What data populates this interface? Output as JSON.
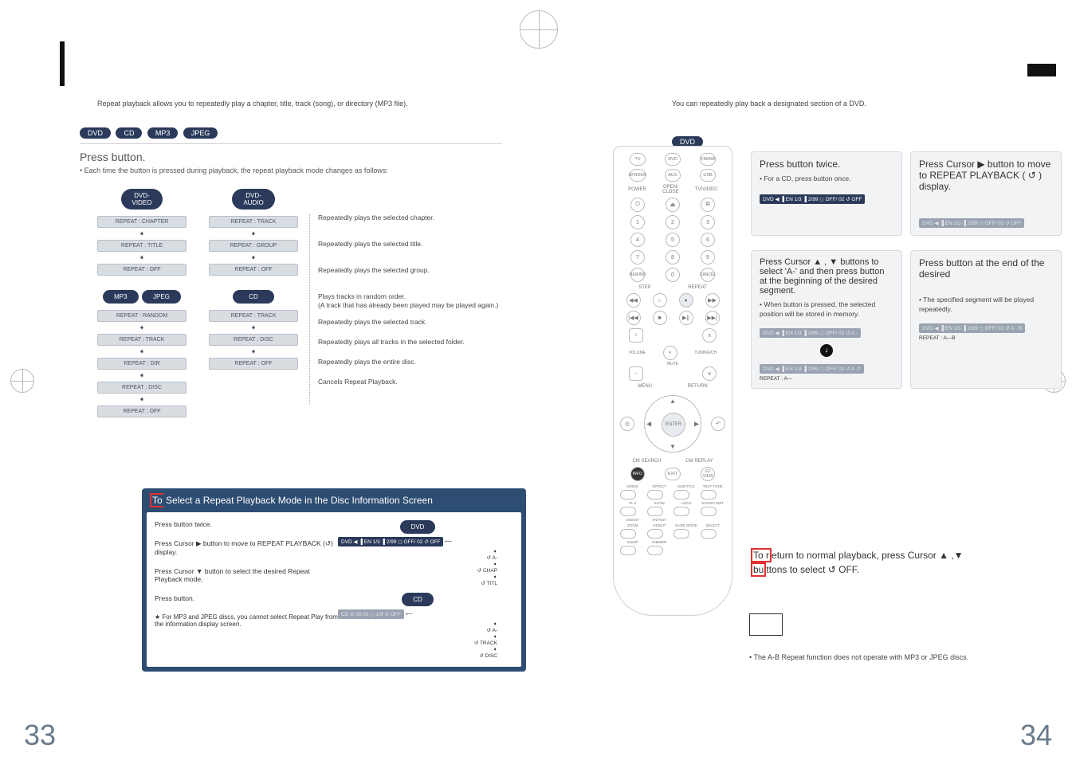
{
  "left": {
    "intro": "Repeat playback allows you to repeatedly play a chapter, title, track (song), or directory (MP3 file).",
    "pills": [
      "DVD",
      "CD",
      "MP3",
      "JPEG"
    ],
    "press_title": "Press                 button.",
    "press_sub": "• Each time the button is pressed during playback, the repeat playback mode changes as follows:",
    "trees": {
      "dvd_video": {
        "label": "DVD-\nVIDEO",
        "items": [
          "REPEAT : CHAPTER",
          "REPEAT : TITLE",
          "REPEAT : OFF"
        ]
      },
      "dvd_audio": {
        "label": "DVD-\nAUDIO",
        "items": [
          "REPEAT : TRACK",
          "REPEAT : GROUP",
          "REPEAT : OFF"
        ]
      },
      "mp3_jpeg": {
        "label_a": "MP3",
        "label_b": "JPEG",
        "items": [
          "REPEAT : RANDOM",
          "REPEAT : TRACK",
          "REPEAT : DIR",
          "REPEAT : DISC",
          "REPEAT : OFF"
        ]
      },
      "cd": {
        "label": "CD",
        "items": [
          "REPEAT : TRACK",
          "REPEAT : DISC",
          "REPEAT : OFF"
        ]
      }
    },
    "descs": [
      "Repeatedly plays the selected chapter.",
      "Repeatedly plays the selected title.",
      "Repeatedly plays the selected group.",
      "Plays tracks in random order.\n(A track that has already been played may be played again.)",
      "Repeatedly plays the selected track.",
      "Repeatedly plays all tracks in the selected folder.",
      "Repeatedly plays the entire disc.",
      "Cancels Repeat Playback."
    ],
    "blue_panel": {
      "title": "To Select a Repeat Playback Mode in the Disc Information Screen",
      "steps": [
        "Press            button twice.",
        "Press Cursor ▶ button to move to REPEAT PLAYBACK (↺) display.",
        "Press Cursor ▼ button to select the desired Repeat Playback mode.",
        "Press            button."
      ],
      "footnote": "★ For MP3 and JPEG discs, you cannot select Repeat Play from the information display screen.",
      "dvd_pill": "DVD",
      "cd_pill": "CD",
      "osd1": "DVD  ◀ ▐ EN 1/3 ▐ 2/99 ◻ OFF/ 02  ↺ OFF",
      "list1": [
        "↺ A-",
        "↺ CHAP",
        "↺ TITL"
      ],
      "osd2": "CD  ⊘ 00:02  ◻ 1/9     ↺ OFF",
      "list2": [
        "↺ A-",
        "↺ TRACK",
        "↺ DISC"
      ]
    }
  },
  "right": {
    "intro": "You can repeatedly play back a designated section of a DVD.",
    "pill": "DVD",
    "boxes": {
      "b1": {
        "title": "Press              button twice.",
        "sub": "• For a CD, press            button once.",
        "osd": "DVD  ◀ ▐ EN 1/3 ▐ 2/99 ◻ OFF/ 02  ↺ OFF"
      },
      "b2": {
        "title": "Press Cursor ▶ button to move to REPEAT PLAYBACK ( ↺ ) display.",
        "osd": "DVD  ◀ ▐ EN 1/3 ▐ 2/99 ◻ OFF/ 02  ↺ OFF"
      },
      "b3": {
        "title": "Press Cursor ▲ , ▼  buttons to select 'A-' and then press            button at the beginning of the desired segment.",
        "sub": "• When            button is pressed, the selected position will be stored in memory.",
        "osd1": "DVD  ◀ ▐ EN 1/3 ▐ 2/99 ◻ OFF/ 02  ↺ A -",
        "osd2": "DVD  ◀ ▐ EN 1/3 ▐ 2/99 ◻ OFF/ 02  ↺ A -?",
        "caption": "REPEAT : A—"
      },
      "b4": {
        "title": "Press            button at the end of the desired",
        "sub": "• The specified segment will be played repeatedly.",
        "osd": "DVD  ◀ ▐ EN 1/3 ▐ 2/99 ◻ OFF/ 02  ↺ A - B",
        "caption": "REPEAT : A—B"
      }
    },
    "return_line": "To return to normal playback, press Cursor ▲ ,▼ buttons to select ↺ OFF.",
    "note": "• The A-B Repeat function does not operate with MP3 or JPEG discs."
  },
  "remote": {
    "row1": [
      "TV",
      "DVD",
      "FM/AM"
    ],
    "row2": [
      "D/VIDEO",
      "AUX",
      "USB"
    ],
    "labels_top": [
      "POWER",
      "OPEN/\nCLOSE",
      "TV/VIDEO"
    ],
    "nums": [
      "1",
      "2",
      "3",
      "4",
      "5",
      "6",
      "7",
      "8",
      "9"
    ],
    "row_mid": [
      "REWIND",
      "0",
      "CANCEL"
    ],
    "step_repeat": [
      "STEP",
      "REPEAT"
    ],
    "mid2": [
      "|◀◀",
      "■",
      "▶||",
      "▶▶|"
    ],
    "plus": "+",
    "minus": "−",
    "mute": "MUTE",
    "tune": "TUNING/CH",
    "volume": "VOLUME",
    "menu": "MENU",
    "return": "RETURN",
    "enter": "ENTER",
    "info": "INFO",
    "exit": "EXIT",
    "ez": "EZ VIEW",
    "search_replay": [
      "CM SEARCH",
      "CM REPLAY"
    ],
    "bottom": [
      "MODE",
      "EFFECT",
      "SUBTITLE",
      "TEST TONE",
      "PL II",
      "SLOW",
      "LOGO",
      "SOUND EDIT",
      "DIGEST",
      "ANYKEY",
      "",
      "",
      "ZOOM",
      "HDMI P",
      "SLIDE MODE",
      "SELECT",
      "",
      "",
      "",
      "",
      "SLEEP",
      "DIMMER"
    ]
  },
  "pages": {
    "left": "33",
    "right": "34"
  }
}
